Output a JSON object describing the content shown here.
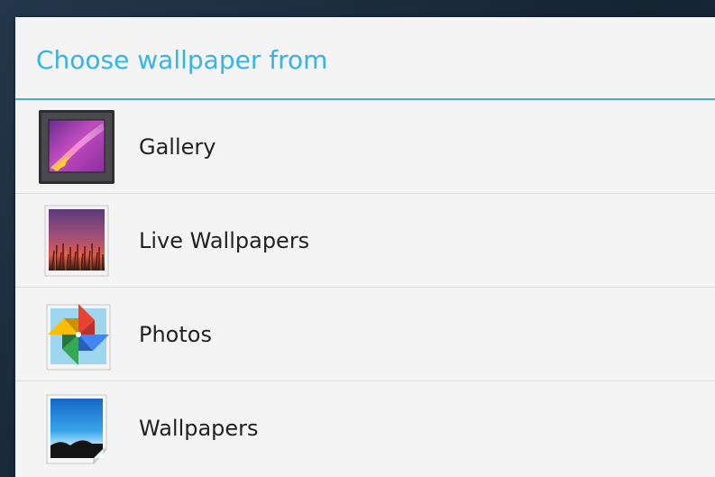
{
  "dialog": {
    "title": "Choose wallpaper from",
    "accent_color": "#33b5e5",
    "options": [
      {
        "label": "Gallery",
        "icon": "gallery-icon"
      },
      {
        "label": "Live Wallpapers",
        "icon": "live-wallpapers-icon"
      },
      {
        "label": "Photos",
        "icon": "photos-icon"
      },
      {
        "label": "Wallpapers",
        "icon": "wallpapers-icon"
      }
    ]
  }
}
